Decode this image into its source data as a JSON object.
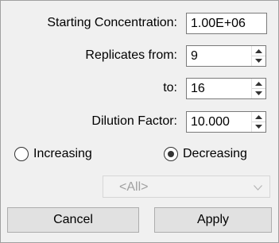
{
  "form": {
    "starting_concentration": {
      "label": "Starting Concentration:",
      "value": "1.00E+06"
    },
    "replicates_from": {
      "label": "Replicates from:",
      "value": "9"
    },
    "replicates_to": {
      "label": "to:",
      "value": "16"
    },
    "dilution_factor": {
      "label": "Dilution Factor:",
      "value": "10.000"
    }
  },
  "direction": {
    "increasing_label": "Increasing",
    "decreasing_label": "Decreasing",
    "selected": "Decreasing"
  },
  "filter": {
    "value": "<All>",
    "enabled": false
  },
  "buttons": {
    "cancel": "Cancel",
    "apply": "Apply"
  },
  "icons": {
    "spinner_up": "chevron-up-icon",
    "spinner_down": "chevron-down-icon",
    "dropdown": "chevron-down-icon"
  }
}
